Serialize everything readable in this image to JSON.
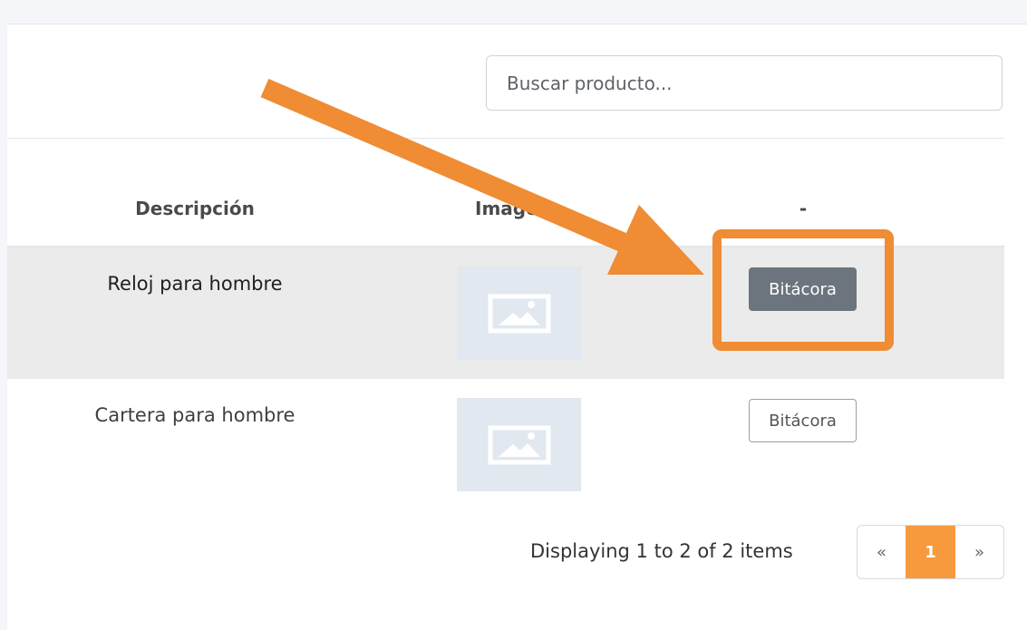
{
  "search": {
    "placeholder": "Buscar producto..."
  },
  "table": {
    "headers": [
      "Descripción",
      "Image",
      "-"
    ],
    "rows": [
      {
        "description": "Reloj para hombre",
        "image_icon": "image-placeholder-icon",
        "button_label": "Bitácora"
      },
      {
        "description": "Cartera para hombre",
        "image_icon": "image-placeholder-icon",
        "button_label": "Bitácora"
      }
    ]
  },
  "pagination": {
    "info": "Displaying 1 to 2 of 2 items",
    "prev": "«",
    "current": "1",
    "next": "»"
  },
  "annotation": {
    "arrow_color": "#ef8c34",
    "highlight_color": "#ef8c34"
  },
  "colors": {
    "accent": "#f79a3e",
    "button_dark": "#6c757d"
  }
}
